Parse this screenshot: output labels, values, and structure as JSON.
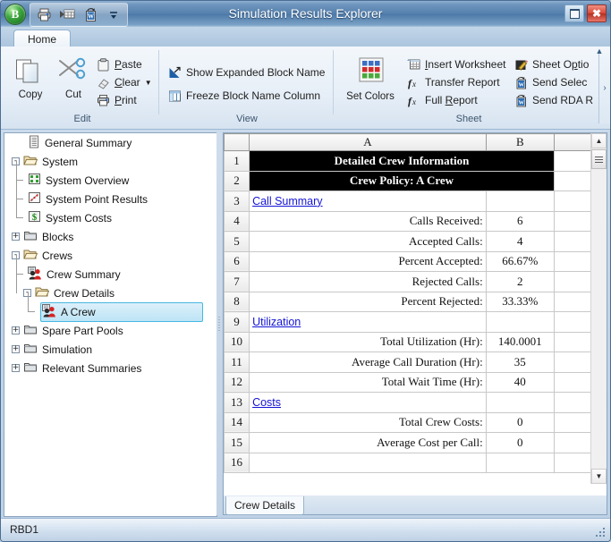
{
  "window": {
    "title": "Simulation Results Explorer",
    "orb_label": "B",
    "restore_icon": "restore-icon",
    "close_icon": "close-icon",
    "quick_access": [
      {
        "name": "print-icon",
        "label": "Print"
      },
      {
        "name": "transfer-report-icon",
        "label": "Transfer Report"
      },
      {
        "name": "send-to-word-icon",
        "label": "Send to Word"
      },
      {
        "name": "customize-qat-icon",
        "label": "Customize Quick Access Toolbar"
      }
    ]
  },
  "tabs": [
    {
      "label": "Home",
      "active": true
    }
  ],
  "ribbon": {
    "collapse_icon": "chevron-up-icon",
    "overflow_icon": "chevron-right-icon",
    "groups": [
      {
        "name": "edit",
        "label": "Edit",
        "big_buttons": [
          {
            "label": "Copy",
            "icon": "copy-icon"
          },
          {
            "label": "Cut",
            "icon": "scissors-icon"
          }
        ],
        "small_items": [
          {
            "label_pre": "",
            "label_key": "P",
            "label_post": "aste",
            "icon": "clipboard-icon"
          },
          {
            "label_pre": "",
            "label_key": "C",
            "label_post": "lear",
            "icon": "eraser-icon",
            "dropdown": true
          },
          {
            "label_pre": "",
            "label_key": "P",
            "label_post": "rint",
            "icon": "printer-icon"
          }
        ]
      },
      {
        "name": "view",
        "label": "View",
        "small_items": [
          {
            "label": "Show Expanded Block Name",
            "icon": "expand-arrow-icon"
          },
          {
            "label": "Freeze Block Name Column",
            "icon": "freeze-column-icon"
          }
        ]
      },
      {
        "name": "sheet",
        "label": "Sheet",
        "big_buttons": [
          {
            "label": "Set Colors",
            "icon": "color-grid-icon"
          }
        ],
        "small_items": [
          {
            "label_pre": "",
            "label_key": "I",
            "label_post": "nsert Worksheet",
            "icon": "insert-worksheet-icon"
          },
          {
            "label_pre": "Transfer Report",
            "label_key": "",
            "label_post": "",
            "icon": "function-icon"
          },
          {
            "label_pre": "Full ",
            "label_key": "R",
            "label_post": "eport",
            "icon": "function-icon"
          },
          {
            "label_pre": "Sheet O",
            "label_key": "p",
            "label_post": "tio",
            "icon": "sheet-options-icon",
            "clipped": true
          },
          {
            "label_pre": "Send Selec",
            "label_key": "",
            "label_post": "",
            "icon": "send-to-word-icon",
            "clipped": true
          },
          {
            "label_pre": "Send RDA R",
            "label_key": "",
            "label_post": "",
            "icon": "send-to-word-icon",
            "clipped": true
          }
        ]
      }
    ]
  },
  "tree": {
    "items": [
      {
        "label": "General Summary",
        "depth": 0,
        "expander": "",
        "icon": "general-summary-icon",
        "selected": false
      },
      {
        "label": "System",
        "depth": 0,
        "expander": "-",
        "icon": "folder-open-icon",
        "selected": false
      },
      {
        "label": "System Overview",
        "depth": 1,
        "expander": "",
        "icon": "system-overview-icon",
        "selected": false
      },
      {
        "label": "System Point Results",
        "depth": 1,
        "expander": "",
        "icon": "point-results-icon",
        "selected": false
      },
      {
        "label": "System Costs",
        "depth": 1,
        "expander": "",
        "icon": "costs-dollar-icon",
        "selected": false
      },
      {
        "label": "Blocks",
        "depth": 0,
        "expander": "+",
        "icon": "folder-closed-icon",
        "selected": false
      },
      {
        "label": "Crews",
        "depth": 0,
        "expander": "-",
        "icon": "folder-open-icon",
        "selected": false
      },
      {
        "label": "Crew Summary",
        "depth": 1,
        "expander": "",
        "icon": "crew-icon",
        "selected": false
      },
      {
        "label": "Crew Details",
        "depth": 1,
        "expander": "-",
        "icon": "folder-open-icon",
        "selected": false
      },
      {
        "label": "A Crew",
        "depth": 2,
        "expander": "",
        "icon": "crew-icon",
        "selected": true
      },
      {
        "label": "Spare Part Pools",
        "depth": 0,
        "expander": "+",
        "icon": "folder-closed-icon",
        "selected": false
      },
      {
        "label": "Simulation",
        "depth": 0,
        "expander": "+",
        "icon": "folder-closed-icon",
        "selected": false
      },
      {
        "label": "Relevant Summaries",
        "depth": 0,
        "expander": "+",
        "icon": "folder-closed-icon",
        "selected": false
      }
    ]
  },
  "grid": {
    "columns": [
      "A",
      "B",
      ""
    ],
    "corner": "",
    "rows": [
      {
        "n": "1",
        "type": "title",
        "a": "Detailed Crew Information",
        "b": ""
      },
      {
        "n": "2",
        "type": "title",
        "a": "Crew Policy: A Crew",
        "b": ""
      },
      {
        "n": "3",
        "type": "section",
        "a": "Call Summary",
        "b": ""
      },
      {
        "n": "4",
        "type": "pair",
        "a": "Calls Received:",
        "b": "6"
      },
      {
        "n": "5",
        "type": "pair",
        "a": "Accepted Calls:",
        "b": "4"
      },
      {
        "n": "6",
        "type": "pair",
        "a": "Percent Accepted:",
        "b": "66.67%"
      },
      {
        "n": "7",
        "type": "pair",
        "a": "Rejected Calls:",
        "b": "2"
      },
      {
        "n": "8",
        "type": "pair",
        "a": "Percent Rejected:",
        "b": "33.33%"
      },
      {
        "n": "9",
        "type": "section",
        "a": "Utilization",
        "b": ""
      },
      {
        "n": "10",
        "type": "pair",
        "a": "Total Utilization (Hr):",
        "b": "140.0001"
      },
      {
        "n": "11",
        "type": "pair",
        "a": "Average Call Duration (Hr):",
        "b": "35"
      },
      {
        "n": "12",
        "type": "pair",
        "a": "Total Wait Time (Hr):",
        "b": "40"
      },
      {
        "n": "13",
        "type": "section",
        "a": "Costs",
        "b": ""
      },
      {
        "n": "14",
        "type": "pair",
        "a": "Total Crew Costs:",
        "b": "0"
      },
      {
        "n": "15",
        "type": "pair",
        "a": "Average Cost per Call:",
        "b": "0"
      },
      {
        "n": "16",
        "type": "empty",
        "a": "",
        "b": ""
      }
    ]
  },
  "sheet_tabs": {
    "active": "Crew Details"
  },
  "status": {
    "text": "RBD1"
  },
  "colors": {
    "title_bar": "#4c79a8",
    "selection": "#45b8e0",
    "link": "#1414d6",
    "banner_bg": "#000000"
  }
}
